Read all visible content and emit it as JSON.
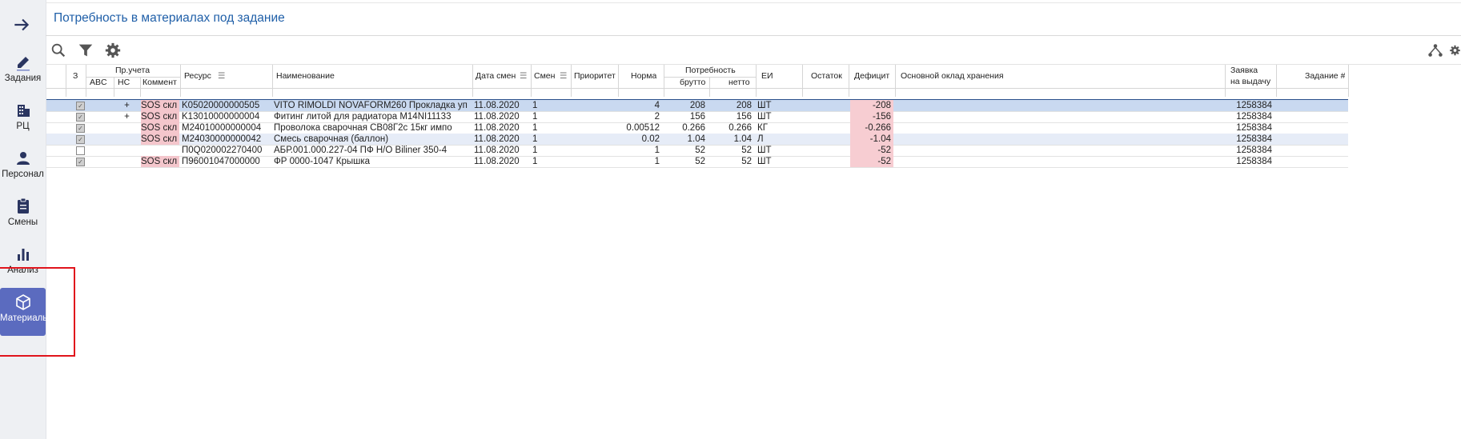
{
  "page": {
    "title": "Потребность в материалах под задание"
  },
  "sidebar": {
    "items": [
      {
        "label": "Задания",
        "icon": "pencil-icon"
      },
      {
        "label": "РЦ",
        "icon": "building-icon"
      },
      {
        "label": "Персонал",
        "icon": "person-icon"
      },
      {
        "label": "Смены",
        "icon": "clipboard-icon"
      },
      {
        "label": "Анализ",
        "icon": "bar-chart-icon"
      },
      {
        "label": "Материалы",
        "icon": "cube-icon",
        "active": true
      }
    ]
  },
  "toolbar": {
    "icons": [
      "search-icon",
      "filter-icon",
      "gear-icon"
    ],
    "right_icons": [
      "hierarchy-icon",
      "gear-icon"
    ]
  },
  "grid": {
    "headers": {
      "z": "З",
      "pr_ucheta": "Пр.учета",
      "abc": "ABC",
      "hc": "НС",
      "comment": "Коммент",
      "resource": "Ресурс",
      "name": "Наименование",
      "date": "Дата смен",
      "smena": "Смен",
      "priority": "Приоритет",
      "norma": "Норма",
      "need": "Потребность",
      "brutto": "брутто",
      "netto": "нетто",
      "ei": "ЕИ",
      "ostatok": "Остаток",
      "deficit": "Дефицит",
      "sklad": "Основной оклад хранения",
      "zayavka": "Заявка",
      "zayavka2": "на выдачу",
      "zadanie": "Задание #"
    },
    "rows": [
      {
        "checked": true,
        "abc": "",
        "hc": "+",
        "comment": "SOS скл",
        "resource": "K05020000000505",
        "name": "VITO RIMOLDI NOVAFORM260 Прокладка уп",
        "date": "11.08.2020",
        "smena": "1",
        "priority": "",
        "norma": "4",
        "brutto": "208",
        "netto": "208",
        "ei": "ШТ",
        "ostatok": "",
        "deficit": "-208",
        "sklad": "",
        "zayavka": "1258384",
        "zadanie": ""
      },
      {
        "checked": true,
        "abc": "",
        "hc": "+",
        "comment": "SOS скл",
        "resource": "K13010000000004",
        "name": "Фитинг литой для радиатора M14NI11133",
        "date": "11.08.2020",
        "smena": "1",
        "priority": "",
        "norma": "2",
        "brutto": "156",
        "netto": "156",
        "ei": "ШТ",
        "ostatok": "",
        "deficit": "-156",
        "sklad": "",
        "zayavka": "1258384",
        "zadanie": ""
      },
      {
        "checked": true,
        "abc": "",
        "hc": "",
        "comment": "SOS скл",
        "resource": "M24010000000004",
        "name": "Проволока сварочная СВ08Г2с 15кг импо",
        "date": "11.08.2020",
        "smena": "1",
        "priority": "",
        "norma": "0.00512",
        "brutto": "0.266",
        "netto": "0.266",
        "ei": "КГ",
        "ostatok": "",
        "deficit": "-0.266",
        "sklad": "",
        "zayavka": "1258384",
        "zadanie": ""
      },
      {
        "checked": true,
        "abc": "",
        "hc": "",
        "comment": "SOS скл",
        "resource": "M24030000000042",
        "name": "Смесь сварочная (баллон)",
        "date": "11.08.2020",
        "smena": "1",
        "priority": "",
        "norma": "0.02",
        "brutto": "1.04",
        "netto": "1.04",
        "ei": "Л",
        "ostatok": "",
        "deficit": "-1.04",
        "sklad": "",
        "zayavka": "1258384",
        "zadanie": ""
      },
      {
        "checked": false,
        "abc": "",
        "hc": "",
        "comment": "",
        "resource": "П0Q020002270400",
        "name": "АБР.001.000.227-04 ПФ Н/О Biliner 350-4",
        "date": "11.08.2020",
        "smena": "1",
        "priority": "",
        "norma": "1",
        "brutto": "52",
        "netto": "52",
        "ei": "ШТ",
        "ostatok": "",
        "deficit": "-52",
        "sklad": "",
        "zayavka": "1258384",
        "zadanie": ""
      },
      {
        "checked": true,
        "abc": "",
        "hc": "",
        "comment": "SOS скл",
        "resource": "П96001047000000",
        "name": "ФР 0000-1047 Крышка",
        "date": "11.08.2020",
        "smena": "1",
        "priority": "",
        "norma": "1",
        "brutto": "52",
        "netto": "52",
        "ei": "ШТ",
        "ostatok": "",
        "deficit": "-52",
        "sklad": "",
        "zayavka": "1258384",
        "zadanie": ""
      }
    ]
  },
  "colors": {
    "accent": "#1f5fa8",
    "sidebar_active": "#5b6bbf",
    "selected_row": "#c9d9f0",
    "alt_row": "#e6ecf7",
    "deficit_bg": "#f7cdd2",
    "comment_bg": "#f4c6cc"
  }
}
